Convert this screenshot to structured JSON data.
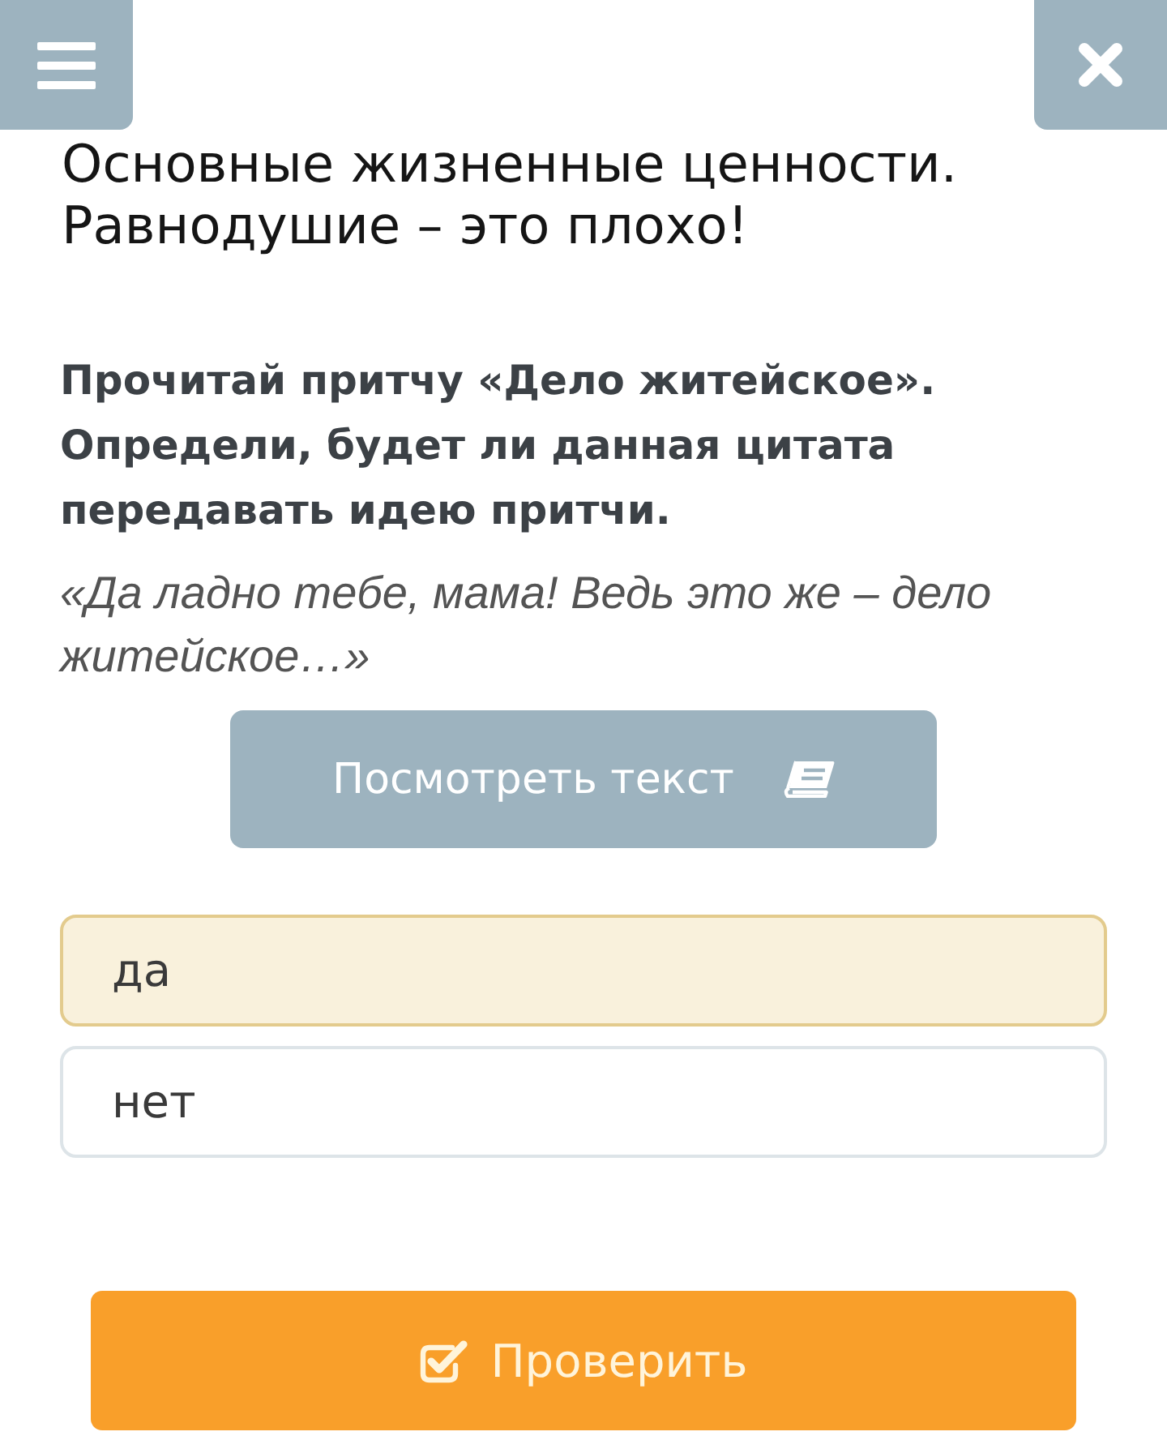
{
  "toolbar": {
    "buttons": [
      {
        "kind": "menu"
      },
      {
        "kind": "close"
      }
    ]
  },
  "lesson": {
    "title": "Основные жизненные ценности. Равнодушие – это плохо!"
  },
  "task": {
    "instruction": "Прочитай притчу «Дело житейское». Определи, будет ли данная цитата передавать идею притчи.",
    "quote": "«Да ладно тебе, мама! Ведь это же – дело житейское…»",
    "view_button": {
      "label": "Посмотреть текст"
    }
  },
  "options": [
    {
      "label": "да",
      "selected": true
    },
    {
      "label": "нет",
      "selected": false
    }
  ],
  "check_button": {
    "label": "Проверить"
  }
}
